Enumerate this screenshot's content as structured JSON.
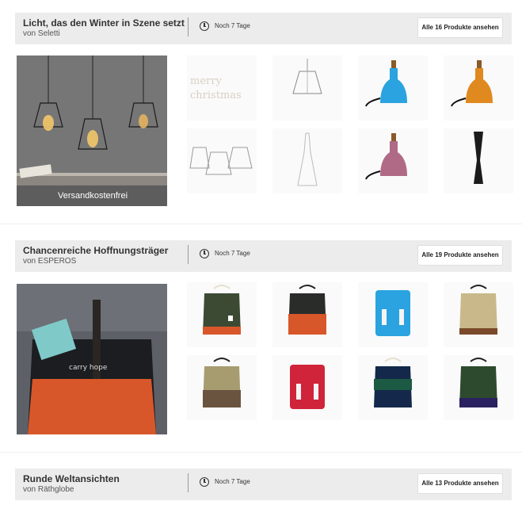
{
  "campaigns": [
    {
      "title": "Licht, das den Winter in Szene setzt",
      "brand": "von Seletti",
      "remaining": "Noch 7 Tage",
      "cta": "Alle 16 Produkte ansehen",
      "badge": "Versandkostenfrei",
      "tile_text": "merry christmas"
    },
    {
      "title": "Chancenreiche Hoffnungsträger",
      "brand": "von ESPEROS",
      "remaining": "Noch 7 Tage",
      "cta": "Alle 19 Produkte ansehen",
      "hero_text": "carry hope"
    },
    {
      "title": "Runde Weltansichten",
      "brand": "von Räthglobe",
      "remaining": "Noch 7 Tage",
      "cta": "Alle 13 Produkte ansehen"
    }
  ],
  "colors": {
    "header_bg": "#ececec",
    "badge_bg": "#5a5a5a",
    "hero_wall": "#6b6b6b",
    "bag_green": "#3c4a33",
    "bag_orange": "#d8572a",
    "bag_blue": "#2aa3e0",
    "bag_red": "#d0243a",
    "bag_navy": "#13284a",
    "bag_tan": "#c9b98a"
  }
}
